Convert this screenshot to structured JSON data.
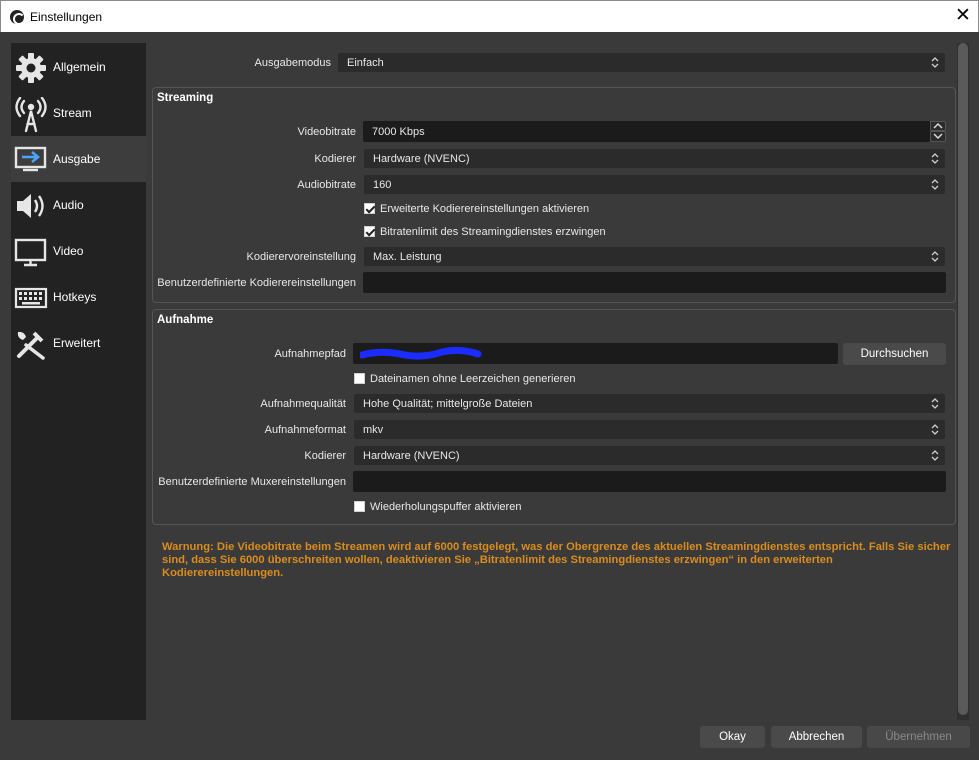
{
  "window": {
    "title": "Einstellungen"
  },
  "sidebar": {
    "items": [
      {
        "label": "Allgemein",
        "icon": "gear-icon"
      },
      {
        "label": "Stream",
        "icon": "antenna-icon"
      },
      {
        "label": "Ausgabe",
        "icon": "output-icon",
        "active": true
      },
      {
        "label": "Audio",
        "icon": "speaker-icon"
      },
      {
        "label": "Video",
        "icon": "monitor-icon"
      },
      {
        "label": "Hotkeys",
        "icon": "keyboard-icon"
      },
      {
        "label": "Erweitert",
        "icon": "tools-icon"
      }
    ]
  },
  "output_mode": {
    "label": "Ausgabemodus",
    "value": "Einfach"
  },
  "streaming": {
    "title": "Streaming",
    "video_bitrate": {
      "label": "Videobitrate",
      "value": "7000 Kbps"
    },
    "encoder": {
      "label": "Kodierer",
      "value": "Hardware (NVENC)"
    },
    "audio_bitrate": {
      "label": "Audiobitrate",
      "value": "160"
    },
    "advanced_encoder": {
      "label": "Erweiterte Kodierereinstellungen aktivieren",
      "checked": true
    },
    "enforce_limits": {
      "label": "Bitratenlimit des Streamingdienstes erzwingen",
      "checked": true
    },
    "encoder_preset": {
      "label": "Kodierervoreinstellung",
      "value": "Max. Leistung"
    },
    "custom_encoder_settings": {
      "label": "Benutzerdefinierte Kodierereinstellungen",
      "value": ""
    }
  },
  "recording": {
    "title": "Aufnahme",
    "path": {
      "label": "Aufnahmepfad",
      "value": ""
    },
    "browse_label": "Durchsuchen",
    "no_spaces": {
      "label": "Dateinamen ohne Leerzeichen generieren",
      "checked": false
    },
    "quality": {
      "label": "Aufnahmequalität",
      "value": "Hohe Qualität; mittelgroße Dateien"
    },
    "format": {
      "label": "Aufnahmeformat",
      "value": "mkv"
    },
    "encoder": {
      "label": "Kodierer",
      "value": "Hardware (NVENC)"
    },
    "custom_muxer": {
      "label": "Benutzerdefinierte Muxereinstellungen",
      "value": ""
    },
    "replay_buffer": {
      "label": "Wiederholungspuffer aktivieren",
      "checked": false
    }
  },
  "warning": "Warnung: Die Videobitrate beim Streamen wird auf 6000 festgelegt, was der Obergrenze des aktuellen Streamingdienstes entspricht. Falls Sie sicher sind, dass Sie 6000 überschreiten wollen, deaktivieren Sie „Bitratenlimit des Streamingdienstes erzwingen“ in den erweiterten Kodierereinstellungen.",
  "buttons": {
    "ok": "Okay",
    "cancel": "Abbrechen",
    "apply": "Übernehmen"
  },
  "colors": {
    "warning": "#d98c1f",
    "sidebar_bg": "#222222",
    "window_bg": "#3a3a3a",
    "redaction": "#1a2cff"
  }
}
